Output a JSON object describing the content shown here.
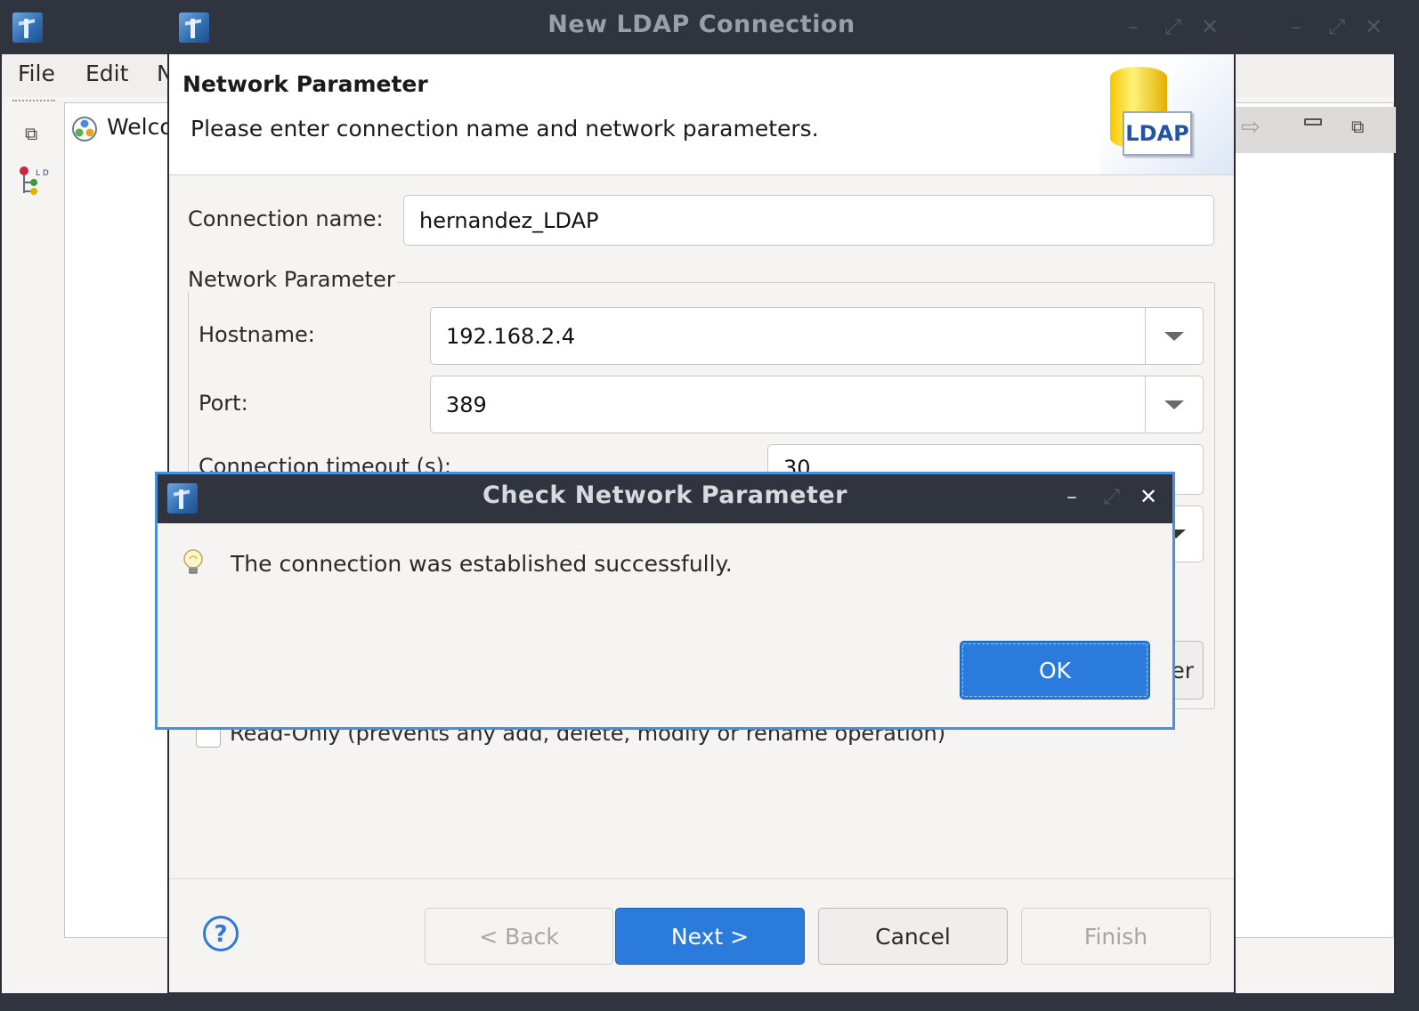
{
  "background_window": {
    "menu": [
      "File",
      "Edit",
      "N"
    ],
    "editor_tab_label": "Welco"
  },
  "wizard": {
    "title": "New LDAP Connection",
    "header": {
      "title": "Network Parameter",
      "description": "Please enter connection name and network parameters.",
      "logo_text": "LDAP"
    },
    "connection_name": {
      "label": "Connection name:",
      "value": "hernandez_LDAP"
    },
    "network_group": {
      "legend": "Network Parameter",
      "hostname": {
        "label": "Hostname:",
        "value": "192.168.2.4"
      },
      "port": {
        "label": "Port:",
        "value": "389"
      },
      "timeout": {
        "label": "Connection timeout (s):",
        "value": "30"
      },
      "partial_button_text": "er"
    },
    "read_only": {
      "label": "Read-Only (prevents any add, delete, modify or rename operation)",
      "checked": false
    },
    "buttons": {
      "back": "< Back",
      "next": "Next >",
      "cancel": "Cancel",
      "finish": "Finish"
    },
    "help_symbol": "?"
  },
  "modal": {
    "title": "Check Network Parameter",
    "message": "The connection was established successfully.",
    "ok": "OK",
    "icon": "lightbulb-icon"
  },
  "colors": {
    "titlebar": "#2f343f",
    "accent": "#2a7bdc",
    "modal_border": "#4a90d9"
  }
}
